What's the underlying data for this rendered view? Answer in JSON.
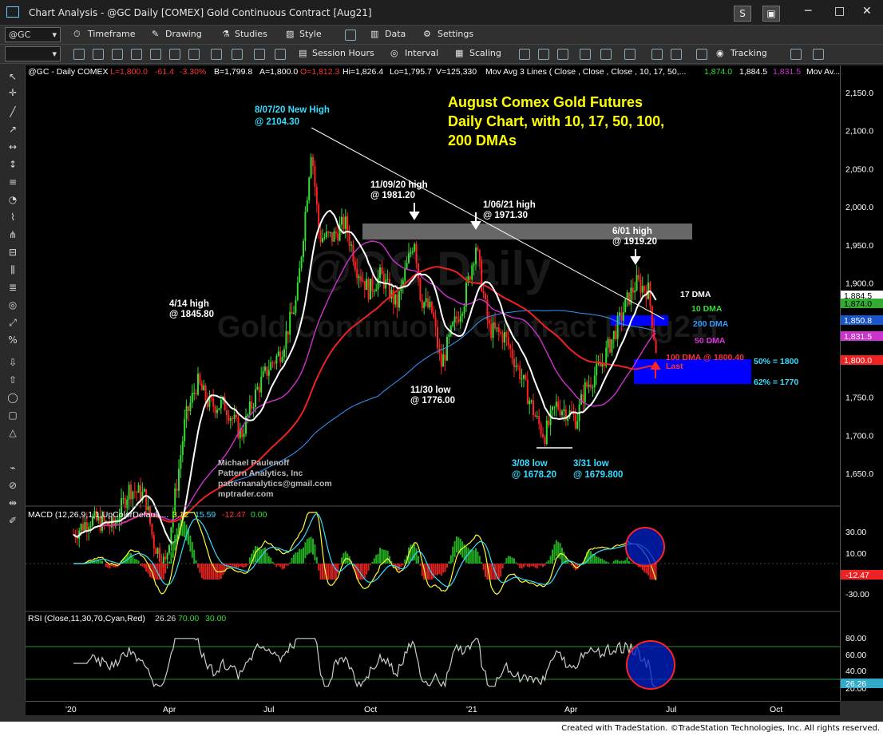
{
  "window": {
    "title": "Chart Analysis - @GC Daily [COMEX] Gold Continuous Contract [Aug21]",
    "btn_s": "S",
    "btn_copy": "",
    "btn_min": "─",
    "btn_max": "□",
    "btn_close": "✕"
  },
  "toolbar1": {
    "symbol": "@GC",
    "timeframe": "Timeframe",
    "drawing": "Drawing",
    "studies": "Studies",
    "style": "Style",
    "data": "Data",
    "settings": "Settings"
  },
  "toolbar2": {
    "session": "Session Hours",
    "interval": "Interval",
    "scaling": "Scaling",
    "tracking": "Tracking"
  },
  "legend": {
    "symbol": "@GC - Daily  COMEX",
    "last": "L=1,800.0",
    "chg": "-61.4",
    "pct": "-3.30%",
    "bid": "B=1,799.8",
    "ask": "A=1,800.0",
    "open": "O=1,812.3",
    "high": "Hi=1,826.4",
    "low": "Lo=1,795.7",
    "vol": "V=125,330",
    "mav": "Mov Avg 3 Lines (  Close ,  Close ,  Close , 10, 17, 50,...",
    "mav1": "1,874.0",
    "mav2": "1,884.5",
    "mav3": "1,831.5",
    "mav_more": "Mov Av..."
  },
  "annotations": {
    "headline1": "August Comex Gold Futures",
    "headline2": "Daily Chart, with 10, 17, 50, 100,",
    "headline3": "200 DMAs",
    "high_aug": "8/07/20 New High",
    "high_aug_v": "@ 2104.30",
    "high_nov": "11/09/20 high",
    "high_nov_v": "@ 1981.20",
    "high_jan": "1/06/21 high",
    "high_jan_v": "@ 1971.30",
    "high_jun": "6/01 high",
    "high_jun_v": "@ 1919.20",
    "high_apr": "4/14 high",
    "high_apr_v": "@ 1845.80",
    "low_nov": "11/30 low",
    "low_nov_v": "@ 1776.00",
    "low_mar8": "3/08 low",
    "low_mar8_v": "@ 1678.20",
    "low_mar31": "3/31 low",
    "low_mar31_v": "@ 1679.800",
    "dma17": "17 DMA",
    "dma10": "10 DMA",
    "dma200": "200 DMA",
    "dma50": "50 DMA",
    "dma100": "100 DMA @ 1800.40",
    "last": "Last",
    "fib50": "50% = 1800",
    "fib62": "62% = 1770",
    "author1": "Michael Paulenoff",
    "author2": "Pattern Analytics, Inc",
    "author3": "patternanalytics@gmail.com",
    "author4": "mptrader.com",
    "watermark1": "@GC Daily",
    "watermark2": "Gold Continuous Contract [Aug21]"
  },
  "macd": {
    "label": "MACD (12,26,9,1,1,UpColorDefault,...",
    "v1": "3.12",
    "v2": "15.59",
    "v3": "-12.47",
    "v4": "0.00"
  },
  "rsi": {
    "label": "RSI (Close,11,30,70,Cyan,Red)",
    "v1": "26.26",
    "v2": "70.00",
    "v3": "30.00"
  },
  "price_axis": {
    "ticks": [
      "2,150.0",
      "2,100.0",
      "2,050.0",
      "2,000.0",
      "1,950.0",
      "1,900.0",
      "1,850.0",
      "1,800.0",
      "1,750.0",
      "1,700.0",
      "1,650.0"
    ],
    "tag_mav2": "1,884.5",
    "tag_mav1": "1,874.0",
    "tag_200": "1,850.8",
    "tag_50": "1,831.5",
    "tag_last": "1,800.0"
  },
  "macd_axis": {
    "ticks": [
      "30.00",
      "10.00",
      "-30.00"
    ],
    "tag": "-12.47"
  },
  "rsi_axis": {
    "ticks": [
      "80.00",
      "60.00",
      "40.00",
      "20.00"
    ],
    "tag": "26.26"
  },
  "x_axis": {
    "ticks": [
      "'20",
      "Apr",
      "Jul",
      "Oct",
      "'21",
      "Apr",
      "Jul",
      "Oct"
    ]
  },
  "status": {
    "credit": "Created with TradeStation. ©TradeStation Technologies, Inc. All rights reserved."
  },
  "colors": {
    "up": "#33dd33",
    "down": "#ff2222",
    "dma10": "#ffffff",
    "dma17": "#ffffff",
    "dma50": "#cc33cc",
    "dma100": "#ee2222",
    "dma200": "#3399ff",
    "headline": "#ffff00",
    "fibbox": "#0000ff"
  }
}
